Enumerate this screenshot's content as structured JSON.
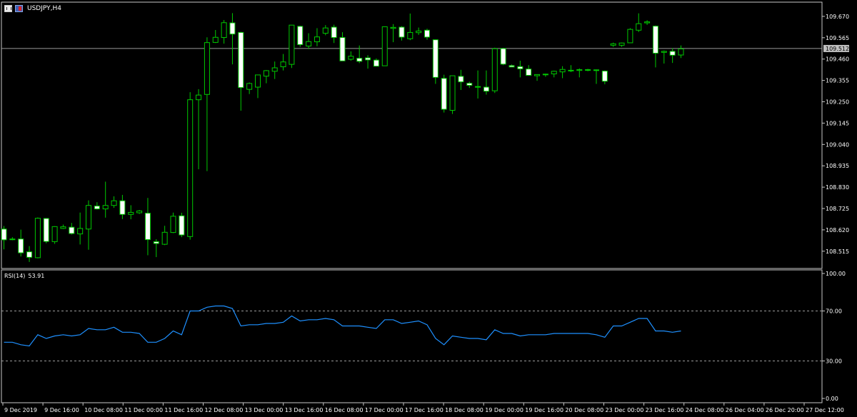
{
  "window": {
    "title": "USDJPY,H4",
    "icons": [
      "chart-window-icon",
      "symbol-flag-icon"
    ]
  },
  "indicator": {
    "name": "RSI(14)",
    "value": "53.91"
  },
  "colors": {
    "background": "#000000",
    "grid_border": "#c8c8c8",
    "bull_candle": "#000000",
    "bull_outline": "#00c800",
    "bear_candle": "#ffffff",
    "wick": "#00c800",
    "rsi_line": "#1e90ff",
    "current_price_line": "#9a9a9a",
    "price_badge_bg": "#c0c0c0"
  },
  "chart_data": [
    {
      "type": "candlestick",
      "symbol": "USDJPY",
      "timeframe": "H4",
      "ylim": [
        108.43,
        109.74
      ],
      "y_ticks": [
        "109.670",
        "109.565",
        "109.460",
        "109.355",
        "109.250",
        "109.145",
        "109.040",
        "108.935",
        "108.830",
        "108.725",
        "108.620",
        "108.515"
      ],
      "current_price": "109.512",
      "candles": [
        {
          "o": 108.624,
          "h": 108.639,
          "l": 108.524,
          "c": 108.571
        },
        {
          "o": 108.573,
          "h": 108.584,
          "l": 108.569,
          "c": 108.575
        },
        {
          "o": 108.575,
          "h": 108.621,
          "l": 108.489,
          "c": 108.507
        },
        {
          "o": 108.512,
          "h": 108.54,
          "l": 108.462,
          "c": 108.485
        },
        {
          "o": 108.483,
          "h": 108.681,
          "l": 108.48,
          "c": 108.677
        },
        {
          "o": 108.676,
          "h": 108.677,
          "l": 108.554,
          "c": 108.563
        },
        {
          "o": 108.562,
          "h": 108.638,
          "l": 108.551,
          "c": 108.636
        },
        {
          "o": 108.627,
          "h": 108.646,
          "l": 108.624,
          "c": 108.635
        },
        {
          "o": 108.633,
          "h": 108.654,
          "l": 108.597,
          "c": 108.602
        },
        {
          "o": 108.6,
          "h": 108.705,
          "l": 108.548,
          "c": 108.627
        },
        {
          "o": 108.624,
          "h": 108.765,
          "l": 108.522,
          "c": 108.74
        },
        {
          "o": 108.737,
          "h": 108.756,
          "l": 108.72,
          "c": 108.723
        },
        {
          "o": 108.723,
          "h": 108.857,
          "l": 108.68,
          "c": 108.74
        },
        {
          "o": 108.74,
          "h": 108.785,
          "l": 108.728,
          "c": 108.763
        },
        {
          "o": 108.763,
          "h": 108.792,
          "l": 108.673,
          "c": 108.696
        },
        {
          "o": 108.696,
          "h": 108.741,
          "l": 108.672,
          "c": 108.706
        },
        {
          "o": 108.704,
          "h": 108.718,
          "l": 108.698,
          "c": 108.713
        },
        {
          "o": 108.702,
          "h": 108.777,
          "l": 108.495,
          "c": 108.572
        },
        {
          "o": 108.562,
          "h": 108.574,
          "l": 108.486,
          "c": 108.553
        },
        {
          "o": 108.549,
          "h": 108.64,
          "l": 108.545,
          "c": 108.608
        },
        {
          "o": 108.607,
          "h": 108.705,
          "l": 108.604,
          "c": 108.687
        },
        {
          "o": 108.689,
          "h": 108.704,
          "l": 108.584,
          "c": 108.595
        },
        {
          "o": 108.587,
          "h": 109.297,
          "l": 108.572,
          "c": 109.26
        },
        {
          "o": 109.26,
          "h": 109.312,
          "l": 108.918,
          "c": 109.283
        },
        {
          "o": 109.286,
          "h": 109.567,
          "l": 108.909,
          "c": 109.541
        },
        {
          "o": 109.542,
          "h": 109.603,
          "l": 109.539,
          "c": 109.567
        },
        {
          "o": 109.566,
          "h": 109.652,
          "l": 109.536,
          "c": 109.639
        },
        {
          "o": 109.638,
          "h": 109.686,
          "l": 109.434,
          "c": 109.583
        },
        {
          "o": 109.591,
          "h": 109.594,
          "l": 109.206,
          "c": 109.32
        },
        {
          "o": 109.311,
          "h": 109.345,
          "l": 109.288,
          "c": 109.34
        },
        {
          "o": 109.322,
          "h": 109.369,
          "l": 109.268,
          "c": 109.382
        },
        {
          "o": 109.376,
          "h": 109.406,
          "l": 109.341,
          "c": 109.403
        },
        {
          "o": 109.4,
          "h": 109.448,
          "l": 109.362,
          "c": 109.417
        },
        {
          "o": 109.422,
          "h": 109.485,
          "l": 109.404,
          "c": 109.446
        },
        {
          "o": 109.434,
          "h": 109.628,
          "l": 109.416,
          "c": 109.627
        },
        {
          "o": 109.621,
          "h": 109.624,
          "l": 109.52,
          "c": 109.531
        },
        {
          "o": 109.524,
          "h": 109.587,
          "l": 109.509,
          "c": 109.546
        },
        {
          "o": 109.545,
          "h": 109.612,
          "l": 109.523,
          "c": 109.569
        },
        {
          "o": 109.587,
          "h": 109.627,
          "l": 109.577,
          "c": 109.613
        },
        {
          "o": 109.617,
          "h": 109.629,
          "l": 109.539,
          "c": 109.566
        },
        {
          "o": 109.566,
          "h": 109.592,
          "l": 109.451,
          "c": 109.451
        },
        {
          "o": 109.459,
          "h": 109.498,
          "l": 109.452,
          "c": 109.474
        },
        {
          "o": 109.464,
          "h": 109.527,
          "l": 109.44,
          "c": 109.449
        },
        {
          "o": 109.466,
          "h": 109.479,
          "l": 109.413,
          "c": 109.456
        },
        {
          "o": 109.455,
          "h": 109.463,
          "l": 109.425,
          "c": 109.425
        },
        {
          "o": 109.427,
          "h": 109.609,
          "l": 109.427,
          "c": 109.619
        },
        {
          "o": 109.611,
          "h": 109.632,
          "l": 109.543,
          "c": 109.616
        },
        {
          "o": 109.617,
          "h": 109.622,
          "l": 109.551,
          "c": 109.568
        },
        {
          "o": 109.56,
          "h": 109.684,
          "l": 109.553,
          "c": 109.591
        },
        {
          "o": 109.59,
          "h": 109.615,
          "l": 109.579,
          "c": 109.598
        },
        {
          "o": 109.602,
          "h": 109.609,
          "l": 109.555,
          "c": 109.568
        },
        {
          "o": 109.555,
          "h": 109.556,
          "l": 109.338,
          "c": 109.37
        },
        {
          "o": 109.365,
          "h": 109.383,
          "l": 109.197,
          "c": 109.213
        },
        {
          "o": 109.208,
          "h": 109.376,
          "l": 109.19,
          "c": 109.378
        },
        {
          "o": 109.375,
          "h": 109.407,
          "l": 109.308,
          "c": 109.348
        },
        {
          "o": 109.341,
          "h": 109.349,
          "l": 109.318,
          "c": 109.331
        },
        {
          "o": 109.323,
          "h": 109.404,
          "l": 109.266,
          "c": 109.325
        },
        {
          "o": 109.322,
          "h": 109.404,
          "l": 109.285,
          "c": 109.302
        },
        {
          "o": 109.304,
          "h": 109.516,
          "l": 109.293,
          "c": 109.511
        },
        {
          "o": 109.512,
          "h": 109.515,
          "l": 109.43,
          "c": 109.435
        },
        {
          "o": 109.428,
          "h": 109.433,
          "l": 109.425,
          "c": 109.421
        },
        {
          "o": 109.423,
          "h": 109.452,
          "l": 109.37,
          "c": 109.412
        },
        {
          "o": 109.411,
          "h": 109.43,
          "l": 109.386,
          "c": 109.38
        },
        {
          "o": 109.378,
          "h": 109.385,
          "l": 109.353,
          "c": 109.384
        },
        {
          "o": 109.385,
          "h": 109.388,
          "l": 109.373,
          "c": 109.386
        },
        {
          "o": 109.387,
          "h": 109.403,
          "l": 109.37,
          "c": 109.4
        },
        {
          "o": 109.397,
          "h": 109.425,
          "l": 109.366,
          "c": 109.409
        },
        {
          "o": 109.405,
          "h": 109.43,
          "l": 109.396,
          "c": 109.404
        },
        {
          "o": 109.404,
          "h": 109.414,
          "l": 109.37,
          "c": 109.408
        },
        {
          "o": 109.405,
          "h": 109.412,
          "l": 109.4,
          "c": 109.408
        },
        {
          "o": 109.407,
          "h": 109.409,
          "l": 109.338,
          "c": 109.405
        },
        {
          "o": 109.401,
          "h": 109.404,
          "l": 109.336,
          "c": 109.351
        },
        {
          "o": 109.528,
          "h": 109.541,
          "l": 109.52,
          "c": 109.535
        },
        {
          "o": 109.528,
          "h": 109.541,
          "l": 109.52,
          "c": 109.539
        },
        {
          "o": 109.54,
          "h": 109.612,
          "l": 109.54,
          "c": 109.606
        },
        {
          "o": 109.602,
          "h": 109.685,
          "l": 109.593,
          "c": 109.634
        },
        {
          "o": 109.638,
          "h": 109.651,
          "l": 109.628,
          "c": 109.643
        },
        {
          "o": 109.622,
          "h": 109.625,
          "l": 109.419,
          "c": 109.489
        },
        {
          "o": 109.493,
          "h": 109.502,
          "l": 109.438,
          "c": 109.498
        },
        {
          "o": 109.498,
          "h": 109.514,
          "l": 109.441,
          "c": 109.479
        },
        {
          "o": 109.48,
          "h": 109.527,
          "l": 109.465,
          "c": 109.51
        }
      ]
    },
    {
      "type": "line",
      "name": "RSI(14)",
      "ylim": [
        0,
        100
      ],
      "y_ticks": [
        "100.00",
        "70.00",
        "30.00",
        "0.00"
      ],
      "levels": [
        70,
        30
      ],
      "values": [
        45,
        45,
        43,
        42,
        51,
        48,
        50,
        51,
        50,
        51,
        56,
        55,
        55,
        57,
        53,
        53,
        52,
        45,
        45,
        48,
        54,
        51,
        70,
        70,
        73,
        74,
        74,
        72,
        58,
        59,
        59,
        60,
        60,
        61,
        66,
        62,
        63,
        63,
        64,
        63,
        58,
        58,
        58,
        57,
        56,
        63,
        63,
        60,
        61,
        62,
        59,
        48,
        43,
        50,
        49,
        48,
        48,
        47,
        55,
        52,
        52,
        50,
        51,
        51,
        51,
        52,
        52,
        52,
        52,
        52,
        51,
        49,
        58,
        58,
        61,
        64,
        64,
        54,
        54,
        53,
        54
      ]
    }
  ],
  "x_axis": {
    "labels": [
      "9 Dec 2019",
      "9 Dec 16:00",
      "10 Dec 08:00",
      "11 Dec 00:00",
      "11 Dec 16:00",
      "12 Dec 08:00",
      "13 Dec 00:00",
      "13 Dec 16:00",
      "16 Dec 08:00",
      "17 Dec 00:00",
      "17 Dec 16:00",
      "18 Dec 08:00",
      "19 Dec 00:00",
      "19 Dec 16:00",
      "20 Dec 08:00",
      "23 Dec 00:00",
      "23 Dec 16:00",
      "24 Dec 08:00",
      "26 Dec 04:00",
      "26 Dec 20:00",
      "27 Dec 12:00"
    ]
  }
}
